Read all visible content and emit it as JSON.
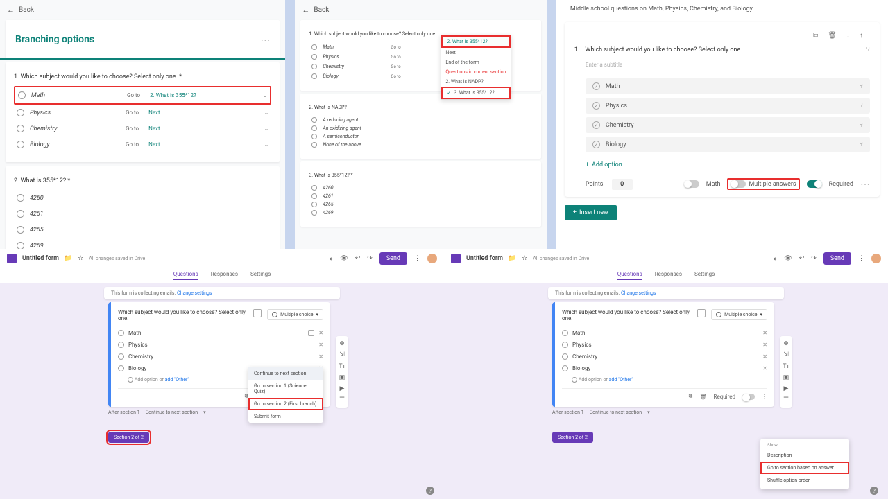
{
  "p1": {
    "back": "Back",
    "title": "Branching options",
    "q1": "1. Which subject would you like to choose? Select only one. *",
    "goto": "Go to",
    "opts": [
      {
        "label": "Math",
        "target": "2. What is 355*12?"
      },
      {
        "label": "Physics",
        "target": "Next"
      },
      {
        "label": "Chemistry",
        "target": "Next"
      },
      {
        "label": "Biology",
        "target": "Next"
      }
    ],
    "q2": "2. What is 355*12? *",
    "ans": [
      "4260",
      "4261",
      "4265",
      "4269"
    ]
  },
  "p2": {
    "back": "Back",
    "q1": "1. Which subject would you like to choose? Select only one.",
    "goto": "Go to",
    "opts": [
      "Math",
      "Physics",
      "Chemistry",
      "Biology"
    ],
    "dd_sel": "2. What is 355*12?",
    "dd": [
      "Next",
      "End of the form",
      "Questions in current section",
      "2. What is NADP?",
      "3. What is 355*12?"
    ],
    "q2": "2. What is NADP?",
    "ans2": [
      "A reducing agent",
      "An oxidizing agent",
      "A semiconductor",
      "None of the above"
    ],
    "q3": "3. What is 355*12? *",
    "ans3": [
      "4260",
      "4261",
      "4265",
      "4269"
    ]
  },
  "p3": {
    "desc": "Middle school questions on Math, Physics, Chemistry, and Biology.",
    "qnum": "1.",
    "q": "Which subject would you like to choose? Select only one.",
    "sub": "Enter a subtitle",
    "opts": [
      "Math",
      "Physics",
      "Chemistry",
      "Biology"
    ],
    "add": "Add option",
    "points": "Points:",
    "points_val": "0",
    "math_lbl": "Math",
    "multi": "Multiple answers",
    "req": "Required",
    "insert": "Insert new"
  },
  "gf": {
    "title": "Untitled form",
    "saved": "All changes saved in Drive",
    "send": "Send",
    "tabs": [
      "Questions",
      "Responses",
      "Settings"
    ],
    "banner": "This form is collecting emails.",
    "banner_link": "Change settings",
    "q": "Which subject would you like to choose? Select only one.",
    "type": "Multiple choice",
    "opts": [
      "Math",
      "Physics",
      "Chemistry",
      "Biology"
    ],
    "add": "Add option",
    "or": "or",
    "other": "add \"Other\"",
    "required": "Required",
    "after": "After section 1",
    "cont": "Continue to next section",
    "sec": "Section 2 of 2",
    "branch_menu": [
      "Continue to next section",
      "Go to section 1 (Science Quiz)",
      "Go to section 2 (First branch)",
      "Submit form"
    ],
    "ctx_show": "Show",
    "ctx": [
      "Description",
      "Go to section based on answer",
      "Shuffle option order"
    ]
  }
}
